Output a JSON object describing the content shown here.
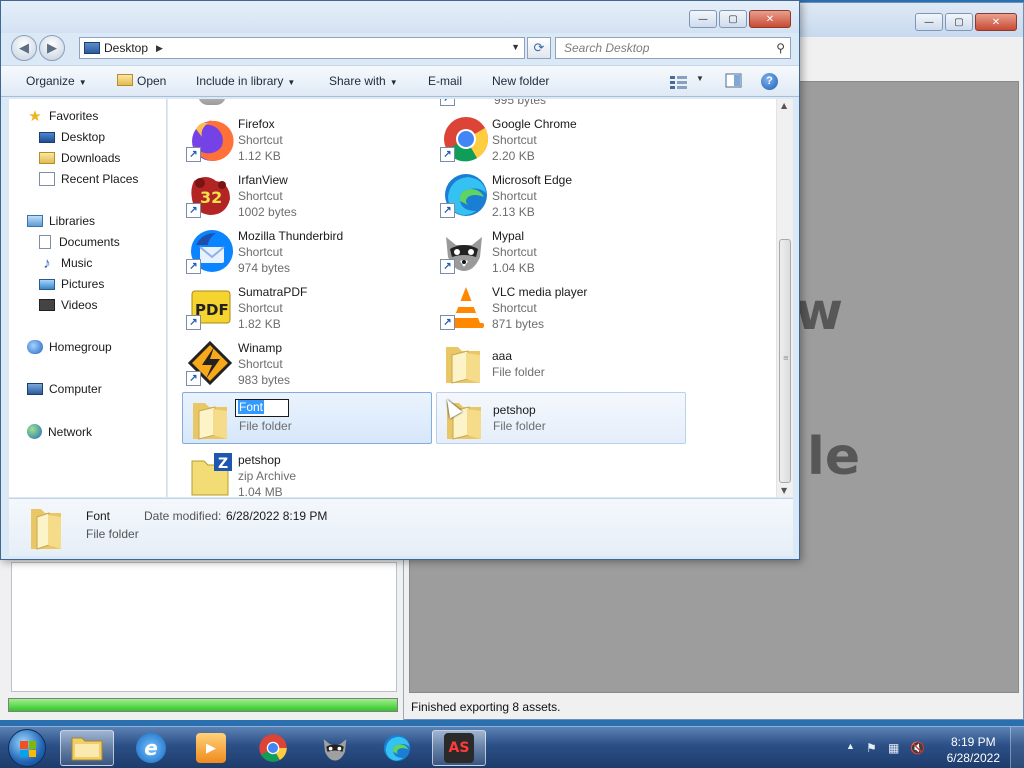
{
  "background_app": {
    "big_text_1": "w",
    "big_text_2": "le",
    "status": "Finished exporting 8 assets.",
    "progress_fraction": 1.0
  },
  "explorer": {
    "address": "Desktop",
    "search_placeholder": "Search Desktop",
    "toolbar": {
      "organize": "Organize",
      "open": "Open",
      "include_in_library": "Include in library",
      "share_with": "Share with",
      "email": "E-mail",
      "new_folder": "New folder"
    },
    "nav": {
      "favorites": "Favorites",
      "desktop": "Desktop",
      "downloads": "Downloads",
      "recent_places": "Recent Places",
      "libraries": "Libraries",
      "documents": "Documents",
      "music": "Music",
      "pictures": "Pictures",
      "videos": "Videos",
      "homegroup": "Homegroup",
      "computer": "Computer",
      "network": "Network"
    },
    "partial_top_right_size": "995 bytes",
    "items": [
      {
        "name": "Firefox",
        "type": "Shortcut",
        "size": "1.12 KB",
        "icon": "firefox-icon"
      },
      {
        "name": "Google Chrome",
        "type": "Shortcut",
        "size": "2.20 KB",
        "icon": "chrome-icon"
      },
      {
        "name": "IrfanView",
        "type": "Shortcut",
        "size": "1002 bytes",
        "icon": "irfanview-icon"
      },
      {
        "name": "Microsoft Edge",
        "type": "Shortcut",
        "size": "2.13 KB",
        "icon": "edge-icon"
      },
      {
        "name": "Mozilla Thunderbird",
        "type": "Shortcut",
        "size": "974 bytes",
        "icon": "thunderbird-icon"
      },
      {
        "name": "Mypal",
        "type": "Shortcut",
        "size": "1.04 KB",
        "icon": "mypal-icon"
      },
      {
        "name": "SumatraPDF",
        "type": "Shortcut",
        "size": "1.82 KB",
        "icon": "sumatrapdf-icon"
      },
      {
        "name": "VLC media player",
        "type": "Shortcut",
        "size": "871 bytes",
        "icon": "vlc-icon"
      },
      {
        "name": "Winamp",
        "type": "Shortcut",
        "size": "983 bytes",
        "icon": "winamp-icon"
      },
      {
        "name": "aaa",
        "type": "File folder",
        "size": "",
        "icon": "folder-icon"
      },
      {
        "name": "Font",
        "type": "File folder",
        "size": "",
        "icon": "folder-icon"
      },
      {
        "name": "petshop",
        "type": "File folder",
        "size": "",
        "icon": "folder-icon"
      },
      {
        "name": "petshop",
        "type": "zip Archive",
        "size": "1.04 MB",
        "icon": "zip-icon"
      }
    ],
    "details": {
      "name": "Font",
      "date_modified_label": "Date modified:",
      "date_modified": "6/28/2022 8:19 PM",
      "type": "File folder"
    }
  },
  "taskbar": {
    "time": "8:19 PM",
    "date": "6/28/2022",
    "as_label": "AS"
  },
  "colors": {
    "selection": "#3399ff",
    "taskbar": "#2b4f86",
    "progress": "#32c42a"
  }
}
